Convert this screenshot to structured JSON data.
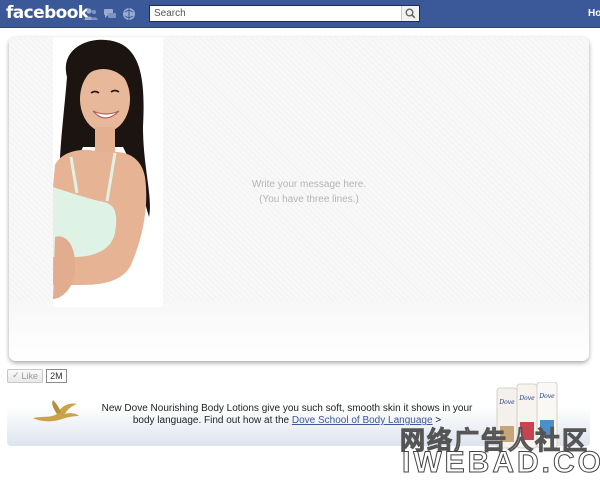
{
  "topbar": {
    "logo": "facebook",
    "jewels": [
      "friends-icon",
      "messages-icon",
      "notifications-icon"
    ],
    "search_placeholder": "Search",
    "home_label": "Ho"
  },
  "canvas": {
    "message_line1": "Write your message here.",
    "message_line2": "(You have three lines.)"
  },
  "like": {
    "button_label": "Like",
    "count": "2M"
  },
  "banner": {
    "text_before": "New Dove Nourishing Body Lotions give you such soft, smooth skin it shows in your body language. Find out how at the ",
    "link_text": "Dove School of Body Language",
    "link_suffix": " >",
    "bottle_brand": "Dove"
  },
  "watermark": {
    "chinese": "网络广告人社区",
    "english": "IWEBAD.CO"
  },
  "colors": {
    "facebook_blue": "#3b5998",
    "link_blue": "#3b5998",
    "dove_gold": "#c9a24a"
  }
}
